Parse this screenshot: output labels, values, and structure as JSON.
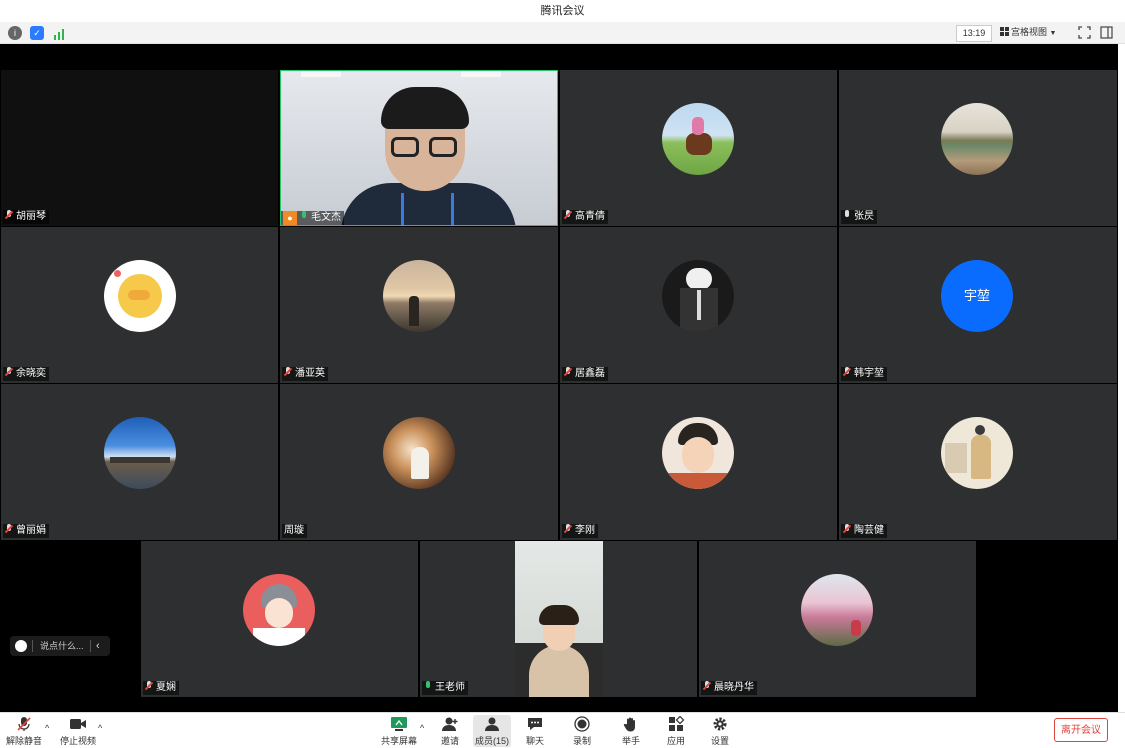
{
  "window": {
    "title": "腾讯会议"
  },
  "infobar": {
    "time": "13:19",
    "view_label": "宫格视图"
  },
  "participants": [
    {
      "name": "胡丽琴",
      "mic": "muted"
    },
    {
      "name": "毛文杰",
      "mic": "on",
      "host": true
    },
    {
      "name": "高青倩",
      "mic": "muted"
    },
    {
      "name": "张昃",
      "mic": "unmuted"
    },
    {
      "name": "余晓奕",
      "mic": "muted"
    },
    {
      "name": "潘亚英",
      "mic": "muted"
    },
    {
      "name": "居鑫磊",
      "mic": "muted"
    },
    {
      "name": "韩宇堃",
      "mic": "muted",
      "initials": "宇堃"
    },
    {
      "name": "曾丽娟",
      "mic": "muted"
    },
    {
      "name": "周璇",
      "mic": "none"
    },
    {
      "name": "李刚",
      "mic": "muted"
    },
    {
      "name": "陶芸健",
      "mic": "muted"
    },
    {
      "name": "夏娴",
      "mic": "muted"
    },
    {
      "name": "王老师",
      "mic": "on"
    },
    {
      "name": "晨晓丹华",
      "mic": "muted"
    }
  ],
  "chat": {
    "placeholder": "说点什么..."
  },
  "toolbar": {
    "unmute": "解除静音",
    "stop_video": "停止视频",
    "share_screen": "共享屏幕",
    "invite": "邀请",
    "members": "成员(15)",
    "chat": "聊天",
    "record": "录制",
    "raise_hand": "举手",
    "apps": "应用",
    "settings": "设置",
    "leave": "离开会议"
  },
  "colors": {
    "accent_blue": "#0a6cff",
    "leave_red": "#e0443e",
    "speaking_green": "#27c46b",
    "tile_bg": "#2e2f30"
  }
}
